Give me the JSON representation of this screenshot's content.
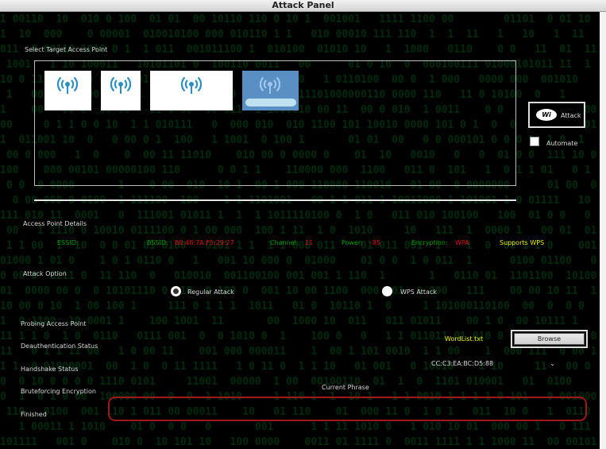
{
  "window": {
    "title": "Attack Panel"
  },
  "target": {
    "section_label": "Select Target Access Point",
    "access_points": [
      "",
      "",
      "",
      ""
    ]
  },
  "actions": {
    "attack_label": "Attack",
    "wifi_logo_text": "Wi",
    "automate_label": "Automate",
    "automate_checked": false
  },
  "details": {
    "section_label": "Access Point Details",
    "essid_label": "ESSID:",
    "essid_value": "",
    "bssid_label": "BSSID:",
    "bssid_value": "B0:48:7A:F5:29:27",
    "channel_label": "Channel:",
    "channel_value": "11",
    "power_label": "Power:",
    "power_value": "-85",
    "encryption_label": "Encryption:",
    "encryption_value": "WPA",
    "wps_label": "Supports WPS"
  },
  "attack_option": {
    "section_label": "Attack Option",
    "regular_label": "Regular Attack",
    "wps_label": "WPS  Attack",
    "selected": "regular"
  },
  "status": {
    "probing": "Probing Access Point",
    "deauth": "Deauthentication Status",
    "handshake": "Handshake Status",
    "bruteforce": "Bruteforcing Encryption",
    "finished": "Finished"
  },
  "wordlist": {
    "file": "WordList.txt",
    "browse_label": "Browse"
  },
  "client": {
    "selected_mac": "CC:C3:EA:BC:D5:88",
    "chevron_icon": "chevron-down-icon"
  },
  "phrase": {
    "label": "Current Phrase",
    "value": ""
  },
  "colors": {
    "label_green": "#00a000",
    "value_red": "#e01010",
    "wps_yellow": "#e8e800",
    "wordlist_yellow": "#f5f500",
    "phrase_border": "#a01818"
  }
}
